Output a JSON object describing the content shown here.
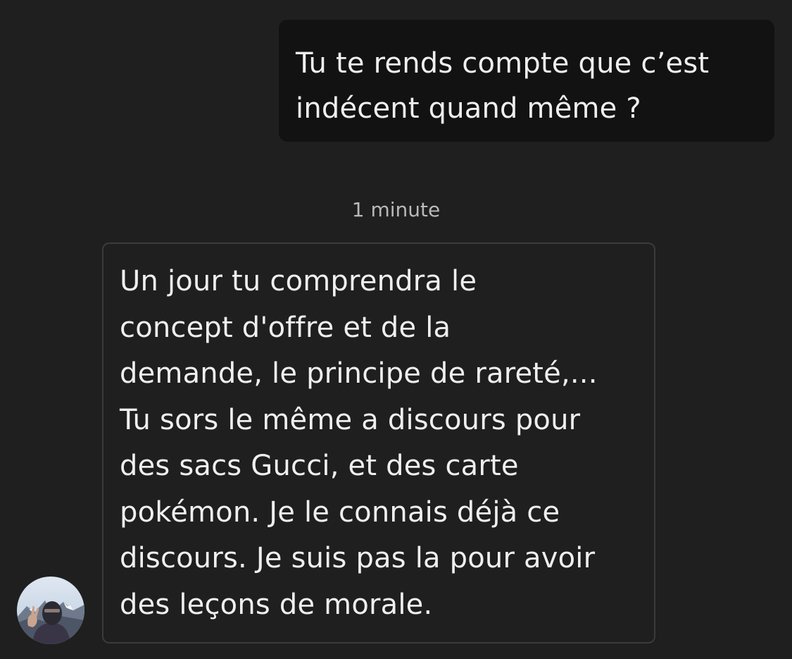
{
  "thread": {
    "messages": [
      {
        "direction": "sent",
        "lines": [
          "Tu te rends compte que c’est",
          "indécent quand même ?"
        ]
      },
      {
        "direction": "received",
        "timestamp": "1 minute",
        "lines": [
          "Un jour tu comprendra le",
          "concept d'offre et de la",
          "demande, le principe de rareté,...",
          "Tu sors le même a discours pour",
          "des sacs Gucci, et des carte",
          "pokémon. Je le connais déjà ce",
          "discours. Je suis pas la pour avoir",
          "des leçons de morale."
        ]
      }
    ]
  },
  "colors": {
    "background": "#1f1f1f",
    "sent_bubble": "#121212",
    "received_border": "#3b3b3b",
    "text": "#efefef",
    "timestamp": "#b9b9b9"
  },
  "avatar": {
    "icon": "user-avatar-photo"
  }
}
